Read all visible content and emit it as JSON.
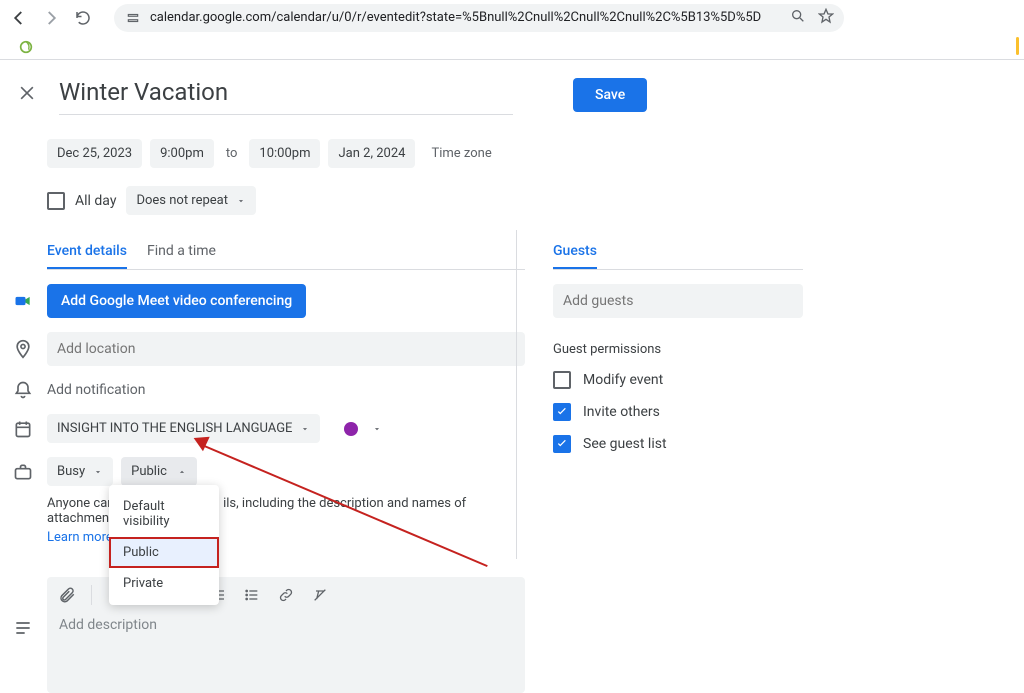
{
  "browser": {
    "url": "calendar.google.com/calendar/u/0/r/eventedit?state=%5Bnull%2Cnull%2Cnull%2Cnull%2C%5B13%5D%5D"
  },
  "event": {
    "title": "Winter Vacation",
    "save_label": "Save",
    "start_date": "Dec 25, 2023",
    "start_time": "9:00pm",
    "to_label": "to",
    "end_time": "10:00pm",
    "end_date": "Jan 2, 2024",
    "timezone_label": "Time zone",
    "all_day_label": "All day",
    "repeat_label": "Does not repeat"
  },
  "tabs": {
    "details": "Event details",
    "findtime": "Find a time"
  },
  "details": {
    "meet_btn": "Add Google Meet video conferencing",
    "location_placeholder": "Add location",
    "notification_label": "Add notification",
    "calendar_name": "INSIGHT INTO THE ENGLISH LANGUAGE",
    "busy_label": "Busy",
    "visibility_label": "Public",
    "visibility_options": {
      "default": "Default visibility",
      "public": "Public",
      "private": "Private"
    },
    "visibility_note_prefix": "Anyone can s",
    "visibility_note_suffix": "ils, including the description and names of attachments.",
    "learn_more": "Learn more a",
    "description_placeholder": "Add description"
  },
  "guests": {
    "tab_label": "Guests",
    "add_placeholder": "Add guests",
    "permissions_title": "Guest permissions",
    "modify": "Modify event",
    "invite": "Invite others",
    "seelist": "See guest list"
  }
}
